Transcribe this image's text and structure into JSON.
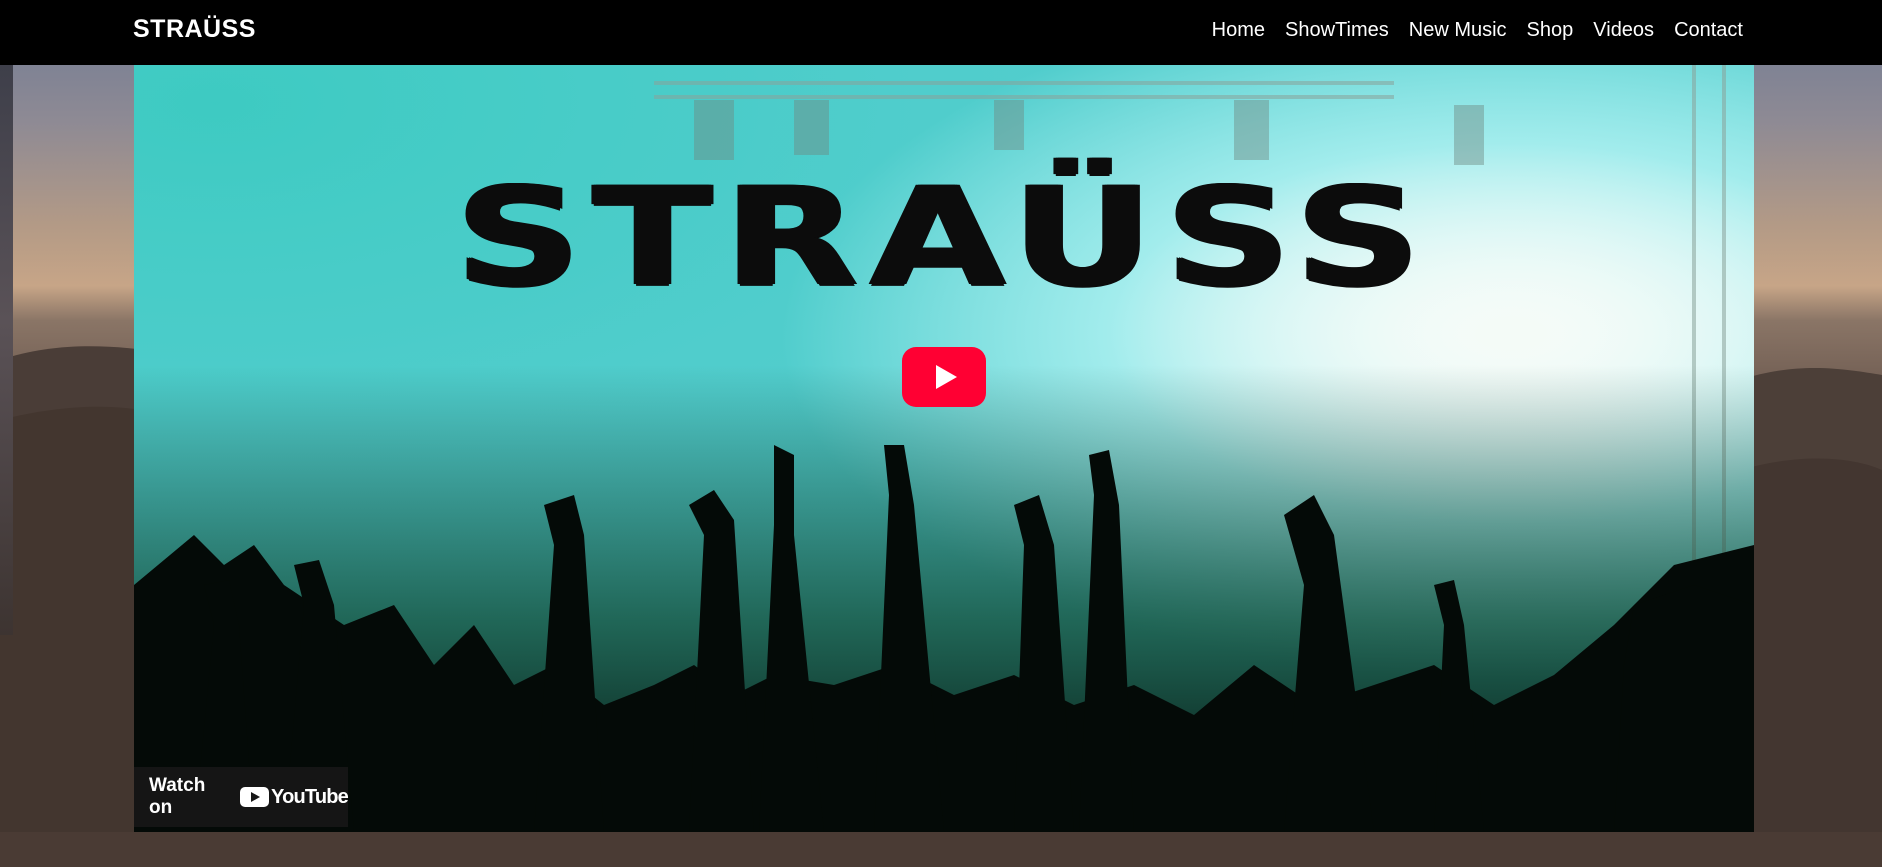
{
  "site": {
    "brand": "STRAÜSS"
  },
  "nav": {
    "items": [
      {
        "label": "Home"
      },
      {
        "label": "ShowTimes"
      },
      {
        "label": "New Music"
      },
      {
        "label": "Shop"
      },
      {
        "label": "Videos"
      },
      {
        "label": "Contact"
      }
    ]
  },
  "video": {
    "title_art": "STRAÜSS",
    "watch_on": "Watch on",
    "platform": "YouTube",
    "play_icon": "play-icon",
    "colors": {
      "play": "#ff0033",
      "glow_left": "#2ee08a",
      "glow_right": "#5ce1e6"
    }
  }
}
